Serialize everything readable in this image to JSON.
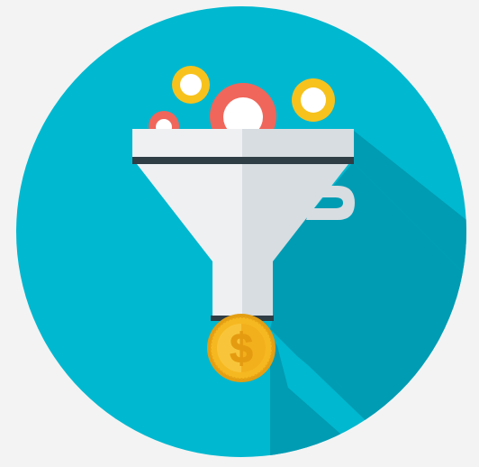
{
  "illustration": {
    "icon": "sales-funnel-icon",
    "coin_symbol": "$",
    "colors": {
      "background": "#f3f3f3",
      "circle": "#00b8d0",
      "shadow": "#009cb3",
      "funnel_light": "#eef0f2",
      "funnel_shade": "#d7dde1",
      "funnel_band": "#2f3d45",
      "coin_gold": "#f6b820",
      "coin_dark": "#e39e12",
      "coin_text": "#f6b820",
      "ball_red": "#f0665a",
      "ball_yellow": "#f7c21c",
      "ball_white": "#ffffff"
    }
  }
}
